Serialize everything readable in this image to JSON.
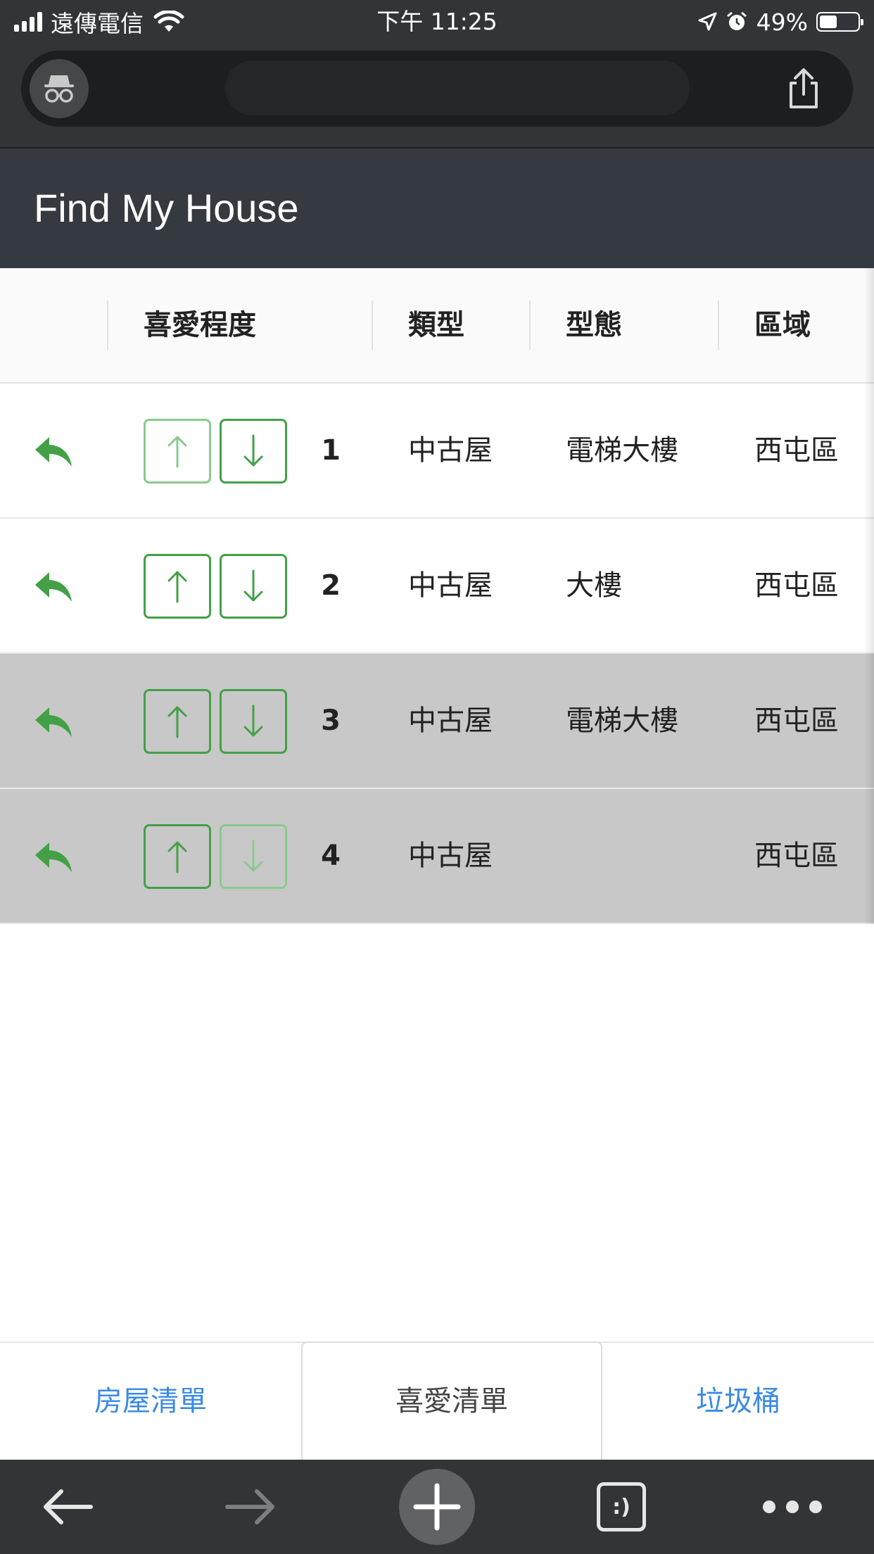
{
  "status_bar": {
    "carrier": "遠傳電信",
    "time": "下午 11:25",
    "battery": "49%",
    "icons": [
      "signal-icon",
      "wifi-icon",
      "location-arrow-icon",
      "alarm-icon",
      "battery-icon"
    ]
  },
  "browser": {
    "incognito_icon": "incognito-icon",
    "share_icon": "share-icon"
  },
  "app": {
    "title": "Find My House",
    "header_bg": "#343a40",
    "accent": "#43a047",
    "link_color": "#3a8ae6"
  },
  "table": {
    "columns": [
      "喜愛程度",
      "類型",
      "型態",
      "區域"
    ],
    "rows": [
      {
        "rank": "1",
        "type": "中古屋",
        "form": "電梯大樓",
        "area": "西屯區",
        "dimmed": false,
        "up_enabled": false,
        "down_enabled": true
      },
      {
        "rank": "2",
        "type": "中古屋",
        "form": "大樓",
        "area": "西屯區",
        "dimmed": false,
        "up_enabled": true,
        "down_enabled": true
      },
      {
        "rank": "3",
        "type": "中古屋",
        "form": "電梯大樓",
        "area": "西屯區",
        "dimmed": true,
        "up_enabled": true,
        "down_enabled": true
      },
      {
        "rank": "4",
        "type": "中古屋",
        "form": "",
        "area": "西屯區",
        "dimmed": true,
        "up_enabled": true,
        "down_enabled": false
      }
    ]
  },
  "tabs": [
    {
      "label": "房屋清單",
      "active": false
    },
    {
      "label": "喜愛清單",
      "active": true
    },
    {
      "label": "垃圾桶",
      "active": false
    }
  ],
  "toolbar": {
    "tab_count": ":)",
    "icons": [
      "back-arrow-icon",
      "forward-arrow-icon",
      "new-tab-plus-icon",
      "tab-switcher-icon",
      "more-menu-icon"
    ]
  }
}
